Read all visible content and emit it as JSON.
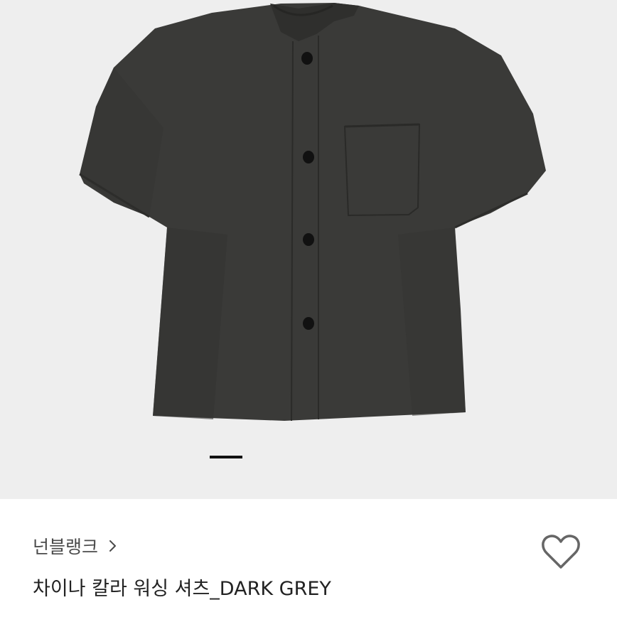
{
  "product": {
    "brand": "넌블랭크",
    "title": "차이나 칼라 워싱 셔츠_DARK GREY"
  },
  "carousel": {
    "current_index": 1
  },
  "icons": {
    "brand_chevron": "chevron-right-icon",
    "like": "heart-outline-icon"
  },
  "colors": {
    "image_background": "#eeeeee",
    "shirt": "#3a3a38",
    "indicator_active": "#111111",
    "text_primary": "#222222",
    "text_secondary": "#4a4a4a"
  }
}
